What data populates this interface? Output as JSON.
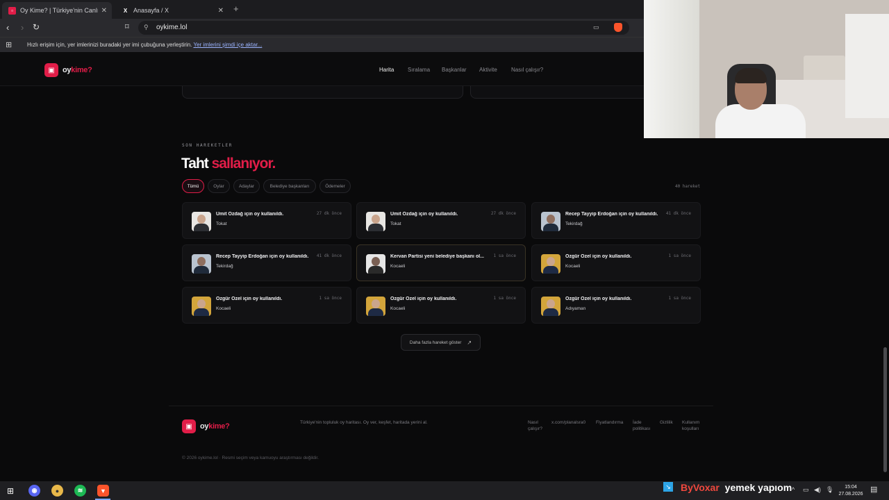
{
  "browser": {
    "tabs": [
      {
        "title": "Oy Kime? | Türkiye'nin Canlı Oy",
        "active": true
      },
      {
        "title": "Anasayfa / X",
        "active": false
      }
    ],
    "url": "oykime.lol",
    "bookmarks_bar": {
      "message": "Hızlı erişim için, yer imlerinizi buradaki yer imi çubuğuna yerleştirin.",
      "link": "Yer imlerini şimdi içe aktar..."
    }
  },
  "site": {
    "logo": {
      "part1": "oy",
      "part2": "kime?"
    },
    "nav": [
      "Harita",
      "Sıralama",
      "Başkanlar",
      "Aktivite",
      "Nasıl çalışır?"
    ],
    "section": {
      "eyebrow": "SON HAREKETLER",
      "headline_white": "Taht",
      "headline_red": "sallanıyor.",
      "filters": [
        "Tümü",
        "Oylar",
        "Adaylar",
        "Belediye başkanları",
        "Ödemeler"
      ],
      "count": "40 hareket"
    },
    "activity": [
      {
        "title": "Ümit Özdağ için oy kullanıldı.",
        "city": "Tokat",
        "time": "27 dk önce",
        "avatar": "person-grey"
      },
      {
        "title": "Ümit Özdağ için oy kullanıldı.",
        "city": "Tokat",
        "time": "27 dk önce",
        "avatar": "person-grey"
      },
      {
        "title": "Recep Tayyip Erdoğan için oy kullanıldı.",
        "city": "Tekirdağ",
        "time": "41 dk önce",
        "avatar": "person-dark"
      },
      {
        "title": "Recep Tayyip Erdoğan için oy kullanıldı.",
        "city": "Tekirdağ",
        "time": "41 dk önce",
        "avatar": "person-dark"
      },
      {
        "title": "Kervan Partisi yeni belediye başkanı ol...",
        "city": "Kocaeli",
        "time": "1 sa önce",
        "avatar": "person-white"
      },
      {
        "title": "Özgür Özel için oy kullanıldı.",
        "city": "Kocaeli",
        "time": "1 sa önce",
        "avatar": "person-gold"
      },
      {
        "title": "Özgür Özel için oy kullanıldı.",
        "city": "Kocaeli",
        "time": "1 sa önce",
        "avatar": "person-gold"
      },
      {
        "title": "Özgür Özel için oy kullanıldı.",
        "city": "Kocaeli",
        "time": "1 sa önce",
        "avatar": "person-gold"
      },
      {
        "title": "Özgür Özel için oy kullanıldı.",
        "city": "Adıyaman",
        "time": "1 sa önce",
        "avatar": "person-gold"
      }
    ],
    "more_button": "Daha fazla hareket göster",
    "footer": {
      "tagline": "Türkiye'nin topluluk oy haritası. Oy ver, keşfet, haritada yerini al.",
      "links": [
        "Nasıl çalışır?",
        "x.com/planalsra0",
        "Fiyatlandırma",
        "İade politikası",
        "Gizlilik",
        "Kullanım koşulları"
      ],
      "copyright": "© 2026 oykime.lol · Resmi seçim veya kamuoyu araştırması değildir."
    }
  },
  "taskbar": {
    "overlay_user": "ByVoxar",
    "overlay_msg": "yemek yapıom",
    "time": "15:04",
    "date": "27.08.2026"
  },
  "colors": {
    "accent": "#e11d48",
    "background": "#0a0a0b",
    "card": "#121214"
  }
}
